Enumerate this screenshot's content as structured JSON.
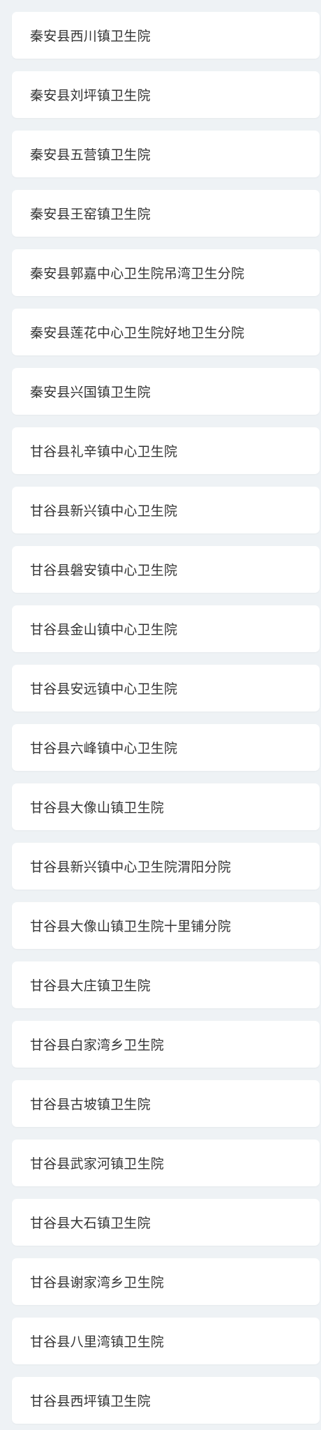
{
  "items": [
    {
      "label": "秦安县西川镇卫生院"
    },
    {
      "label": "秦安县刘坪镇卫生院"
    },
    {
      "label": "秦安县五营镇卫生院"
    },
    {
      "label": "秦安县王窑镇卫生院"
    },
    {
      "label": "秦安县郭嘉中心卫生院吊湾卫生分院"
    },
    {
      "label": "秦安县莲花中心卫生院好地卫生分院"
    },
    {
      "label": "秦安县兴国镇卫生院"
    },
    {
      "label": "甘谷县礼辛镇中心卫生院"
    },
    {
      "label": "甘谷县新兴镇中心卫生院"
    },
    {
      "label": "甘谷县磐安镇中心卫生院"
    },
    {
      "label": "甘谷县金山镇中心卫生院"
    },
    {
      "label": "甘谷县安远镇中心卫生院"
    },
    {
      "label": "甘谷县六峰镇中心卫生院"
    },
    {
      "label": "甘谷县大像山镇卫生院"
    },
    {
      "label": "甘谷县新兴镇中心卫生院渭阳分院"
    },
    {
      "label": "甘谷县大像山镇卫生院十里铺分院"
    },
    {
      "label": "甘谷县大庄镇卫生院"
    },
    {
      "label": "甘谷县白家湾乡卫生院"
    },
    {
      "label": "甘谷县古坡镇卫生院"
    },
    {
      "label": "甘谷县武家河镇卫生院"
    },
    {
      "label": "甘谷县大石镇卫生院"
    },
    {
      "label": "甘谷县谢家湾乡卫生院"
    },
    {
      "label": "甘谷县八里湾镇卫生院"
    },
    {
      "label": "甘谷县西坪镇卫生院"
    }
  ]
}
